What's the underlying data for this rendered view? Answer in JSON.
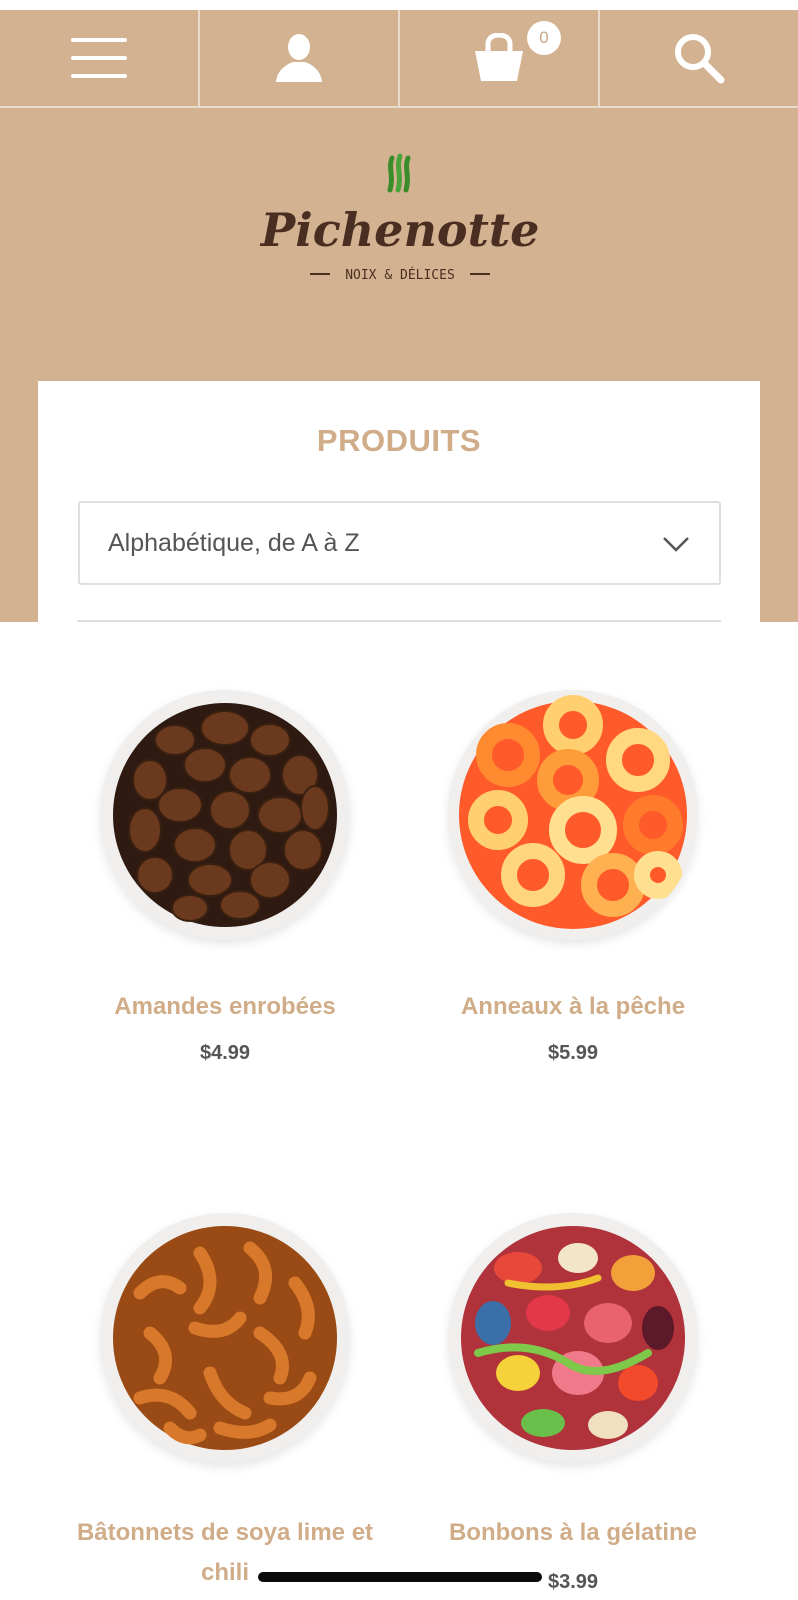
{
  "header": {
    "cart_count": "0",
    "brand": {
      "name": "Pichenotte",
      "tagline": "NOIX & DÉLICES"
    }
  },
  "icons": {
    "menu": "hamburger-menu-icon",
    "account": "user-account-icon",
    "cart": "shopping-basket-icon",
    "search": "magnifier-search-icon",
    "sort": "chevron-down-icon"
  },
  "colors": {
    "header_bg": "#d3b291",
    "accent_text": "#d0ad88",
    "price_text": "#555555",
    "logo_brown": "#4a2e22",
    "logo_green": "#3a8c2a"
  },
  "catalog": {
    "title": "PRODUITS",
    "sort": {
      "selected": "Alphabétique, de A à Z"
    },
    "products": [
      {
        "name": "Amandes enrobées",
        "price": "$4.99",
        "image": "chocolate-coated-almonds"
      },
      {
        "name": "Anneaux à la pêche",
        "price": "$5.99",
        "image": "peach-gummy-rings"
      },
      {
        "name": "Bâtonnets de soya lime et chili",
        "price": "",
        "image": "soy-sticks"
      },
      {
        "name": "Bonbons à la gélatine",
        "price": "$3.99",
        "image": "gummy-candy-mix"
      }
    ]
  }
}
